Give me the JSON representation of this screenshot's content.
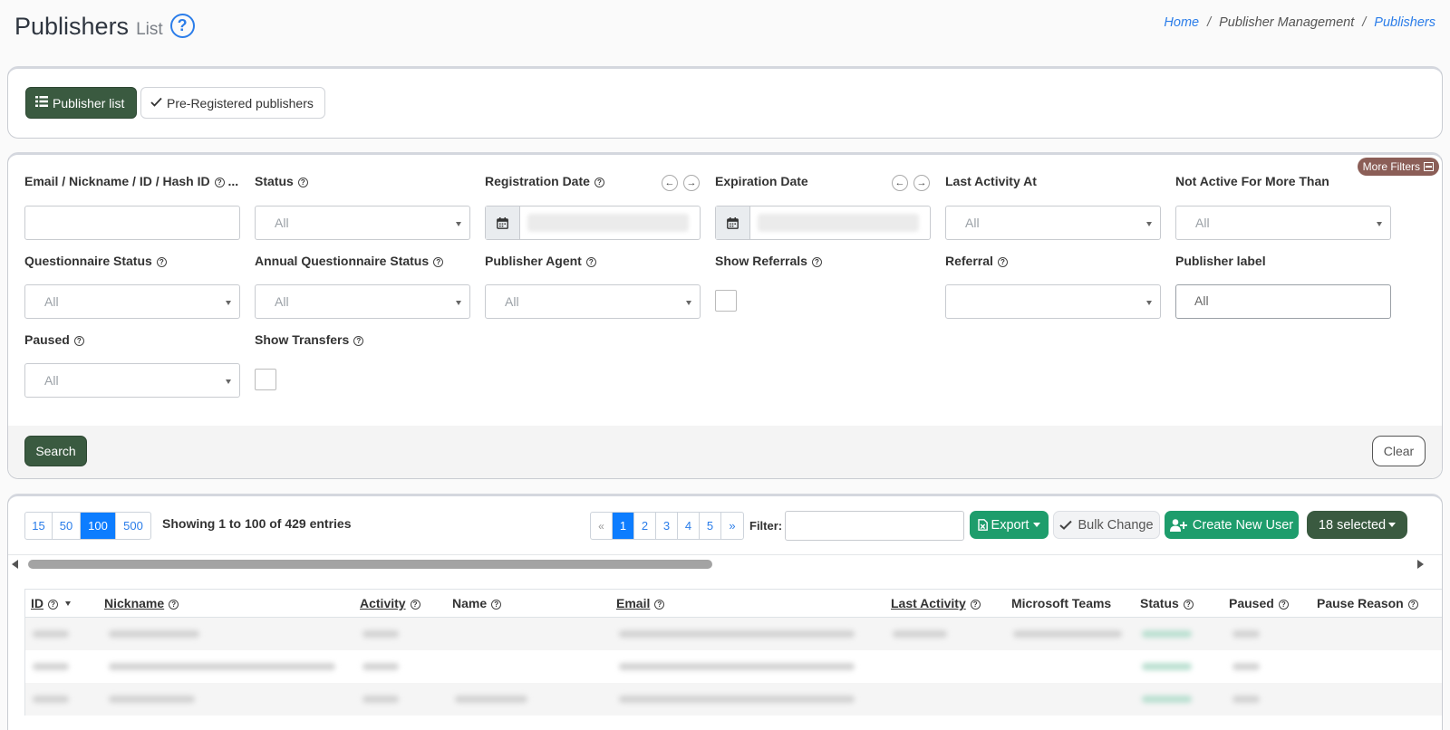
{
  "header": {
    "title": "Publishers",
    "subtitle": "List",
    "help_icon": "question-circle-icon"
  },
  "breadcrumb": {
    "home": "Home",
    "section": "Publisher Management",
    "current": "Publishers",
    "separator": "/"
  },
  "tabs": {
    "publisher_list": "Publisher list",
    "pre_registered": "Pre-Registered publishers"
  },
  "filters": {
    "more_filters": "More Filters",
    "email_label": "Email / Nickname / ID / Hash ID",
    "email_ellipsis": "...",
    "status_label": "Status",
    "status_value": "All",
    "registration_date_label": "Registration Date",
    "expiration_date_label": "Expiration Date",
    "last_activity_label": "Last Activity At",
    "last_activity_value": "All",
    "not_active_label": "Not Active For More Than",
    "not_active_value": "All",
    "questionnaire_status_label": "Questionnaire Status",
    "questionnaire_status_value": "All",
    "annual_questionnaire_label": "Annual Questionnaire Status",
    "annual_questionnaire_value": "All",
    "publisher_agent_label": "Publisher Agent",
    "publisher_agent_value": "All",
    "show_referrals_label": "Show Referrals",
    "referral_label": "Referral",
    "publisher_label_label": "Publisher label",
    "publisher_label_value": "All",
    "paused_label": "Paused",
    "paused_value": "All",
    "show_transfers_label": "Show Transfers",
    "search_button": "Search",
    "clear_button": "Clear"
  },
  "list": {
    "page_sizes": [
      "15",
      "50",
      "100",
      "500"
    ],
    "active_page_size": "100",
    "showing": "Showing 1 to 100 of 429 entries",
    "pager": [
      "«",
      "1",
      "2",
      "3",
      "4",
      "5",
      "»"
    ],
    "active_page": "1",
    "filter_label": "Filter:",
    "export_button": "Export",
    "bulk_change_button": "Bulk Change",
    "create_user_button": "Create New User",
    "selected_button": "18 selected",
    "columns": [
      "ID",
      "Nickname",
      "Activity",
      "Name",
      "Email",
      "Last Activity",
      "Microsoft Teams",
      "Status",
      "Paused",
      "Pause Reason"
    ]
  },
  "colors": {
    "primary_dark_green": "#3a5a40",
    "success_green": "#1e9d6c",
    "link_blue": "#2b7de9",
    "active_blue": "#0d7dff",
    "more_filters_brown": "#8b5e57"
  }
}
